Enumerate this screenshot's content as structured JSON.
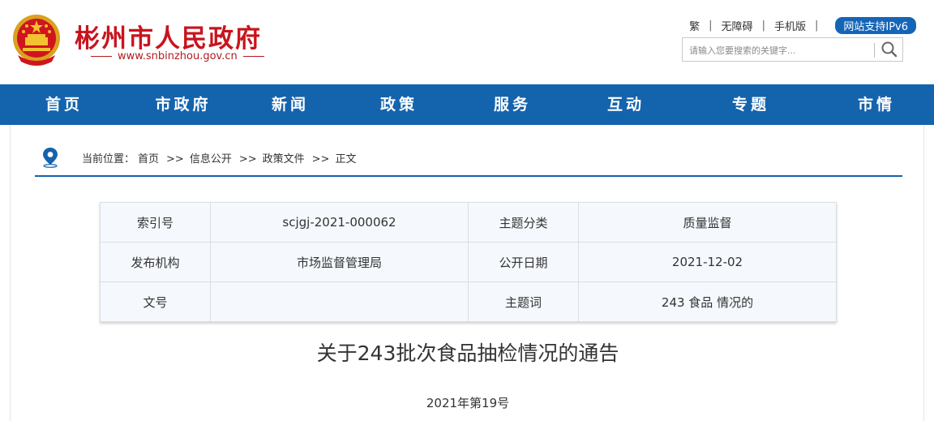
{
  "header": {
    "site_name": "彬州市人民政府",
    "site_url": "www.snbinzhou.gov.cn",
    "top_links": [
      "繁",
      "无障碍",
      "手机版"
    ],
    "ipv6_label": "网站支持IPv6",
    "search_placeholder": "请输入您要搜索的关键字...",
    "brand_color": "#c8141d",
    "nav_color": "#1463ad"
  },
  "nav": {
    "items": [
      "首页",
      "市政府",
      "新闻",
      "政策",
      "服务",
      "互动",
      "专题",
      "市情"
    ]
  },
  "breadcrumb": {
    "prefix": "当前位置：",
    "items": [
      "首页",
      "信息公开",
      "政策文件",
      "正文"
    ],
    "separator": ">>"
  },
  "meta_table": {
    "rows": [
      [
        "索引号",
        "scjgj-2021-000062",
        "主题分类",
        "质量监督"
      ],
      [
        "发布机构",
        "市场监督管理局",
        "公开日期",
        "2021-12-02"
      ],
      [
        "文号",
        "",
        "主题词",
        "243 食品 情况的"
      ]
    ]
  },
  "document": {
    "title": "关于243批次食品抽检情况的通告",
    "number": "2021年第19号"
  }
}
